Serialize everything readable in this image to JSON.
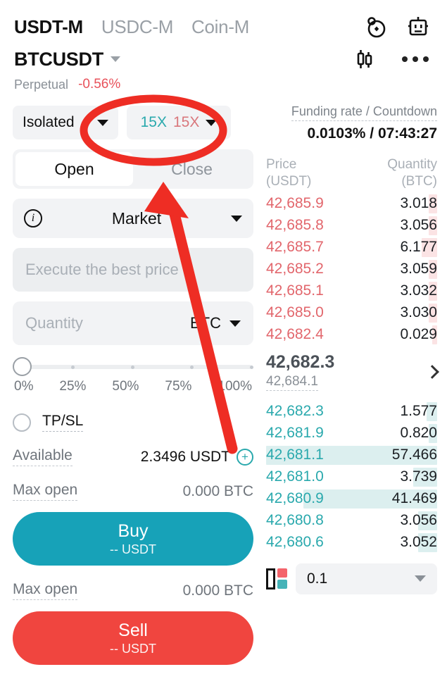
{
  "header": {
    "market_tabs": [
      {
        "label": "USDT-M",
        "active": true
      },
      {
        "label": "USDC-M",
        "active": false
      },
      {
        "label": "Coin-M",
        "active": false
      }
    ],
    "icons": {
      "timer": "timer-icon",
      "bot": "robot-icon",
      "chart": "candlestick-icon",
      "more": "more-options-icon"
    },
    "symbol": "BTCUSDT",
    "contract_type": "Perpetual",
    "change_percent": "-0.56%"
  },
  "order_form": {
    "margin_mode": "Isolated",
    "leverage_long": "15X",
    "leverage_short": "15X",
    "tabs": [
      {
        "label": "Open",
        "active": true
      },
      {
        "label": "Close",
        "active": false
      }
    ],
    "order_type": "Market",
    "price_placeholder": "Execute the best price",
    "quantity_placeholder": "Quantity",
    "quantity_unit": "BTC",
    "slider_ticks": [
      "0%",
      "25%",
      "50%",
      "75%",
      "100%"
    ],
    "slider_value": 0,
    "tpsl_label": "TP/SL",
    "available_label": "Available",
    "available_value": "2.3496 USDT",
    "max_open_label": "Max open",
    "max_open_buy_value": "0.000 BTC",
    "max_open_sell_value": "0.000 BTC",
    "buy_label": "Buy",
    "buy_sub": "-- USDT",
    "sell_label": "Sell",
    "sell_sub": "-- USDT"
  },
  "order_book": {
    "funding_label": "Funding rate / Countdown",
    "funding_value": "0.0103% / 07:43:27",
    "col_price": "Price",
    "col_price_unit": "(USDT)",
    "col_qty": "Quantity",
    "col_qty_unit": "(BTC)",
    "asks": [
      {
        "price": "42,685.9",
        "qty": "3.018",
        "depth": 5
      },
      {
        "price": "42,685.8",
        "qty": "3.056",
        "depth": 5
      },
      {
        "price": "42,685.7",
        "qty": "6.177",
        "depth": 9
      },
      {
        "price": "42,685.2",
        "qty": "3.059",
        "depth": 5
      },
      {
        "price": "42,685.1",
        "qty": "3.032",
        "depth": 5
      },
      {
        "price": "42,685.0",
        "qty": "3.030",
        "depth": 5
      },
      {
        "price": "42,682.4",
        "qty": "0.029",
        "depth": 2
      }
    ],
    "mid_price": "42,682.3",
    "index_price": "42,684.1",
    "bids": [
      {
        "price": "42,682.3",
        "qty": "1.577",
        "depth": 6
      },
      {
        "price": "42,681.9",
        "qty": "0.820",
        "depth": 5
      },
      {
        "price": "42,681.1",
        "qty": "57.466",
        "depth": 100
      },
      {
        "price": "42,681.0",
        "qty": "3.739",
        "depth": 14
      },
      {
        "price": "42,680.9",
        "qty": "41.469",
        "depth": 78
      },
      {
        "price": "42,680.8",
        "qty": "3.056",
        "depth": 11
      },
      {
        "price": "42,680.6",
        "qty": "3.052",
        "depth": 11
      }
    ],
    "tick_size": "0.1",
    "depth_toggle_icon": "depth-view-icon"
  },
  "annotations": {
    "highlight_ellipse": "leverage-selector-highlight",
    "pointer_arrow": "leverage-pointer-arrow",
    "color": "#ee2d24"
  },
  "colors": {
    "accent_teal": "#17a2b8",
    "accent_red": "#f0453f",
    "ask_red": "#e2666c",
    "bid_teal": "#2aa9ad",
    "annotation_red": "#ee2d24"
  }
}
